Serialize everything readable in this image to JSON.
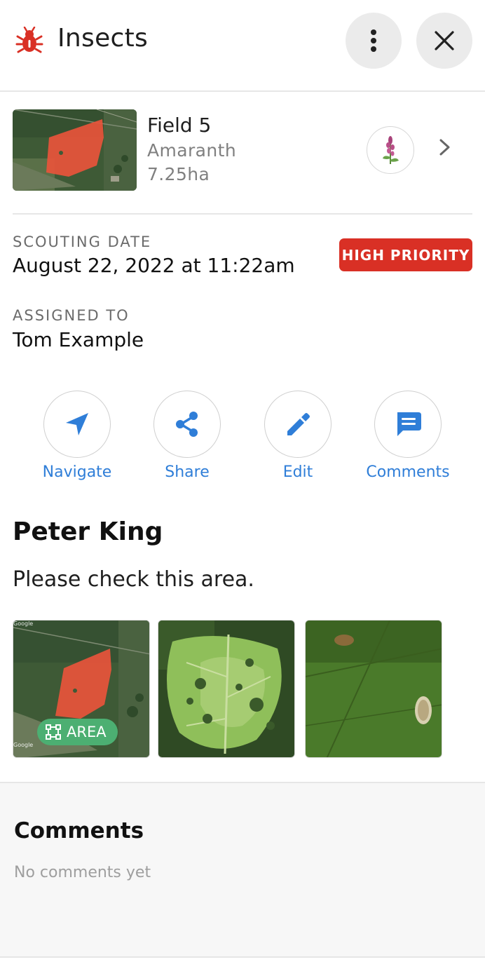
{
  "header": {
    "title": "Insects",
    "icon": "bug-icon",
    "accent_color": "#d93025"
  },
  "field": {
    "name": "Field 5",
    "crop": "Amaranth",
    "area": "7.25ha"
  },
  "scouting": {
    "date_label": "SCOUTING DATE",
    "date_value": "August 22, 2022 at 11:22am",
    "priority": "HIGH PRIORITY",
    "priority_color": "#d93025",
    "assigned_label": "ASSIGNED TO",
    "assigned_value": "Tom Example"
  },
  "actions": [
    {
      "label": "Navigate",
      "icon": "navigation-arrow-icon"
    },
    {
      "label": "Share",
      "icon": "share-icon"
    },
    {
      "label": "Edit",
      "icon": "pencil-icon"
    },
    {
      "label": "Comments",
      "icon": "comment-icon"
    }
  ],
  "note": {
    "author": "Peter King",
    "text": "Please check this area.",
    "area_badge": "AREA",
    "map_credit_top": "Google",
    "map_credit_bottom": "Google"
  },
  "comments": {
    "title": "Comments",
    "empty_text": "No comments yet"
  },
  "link_color": "#2f7ed8"
}
